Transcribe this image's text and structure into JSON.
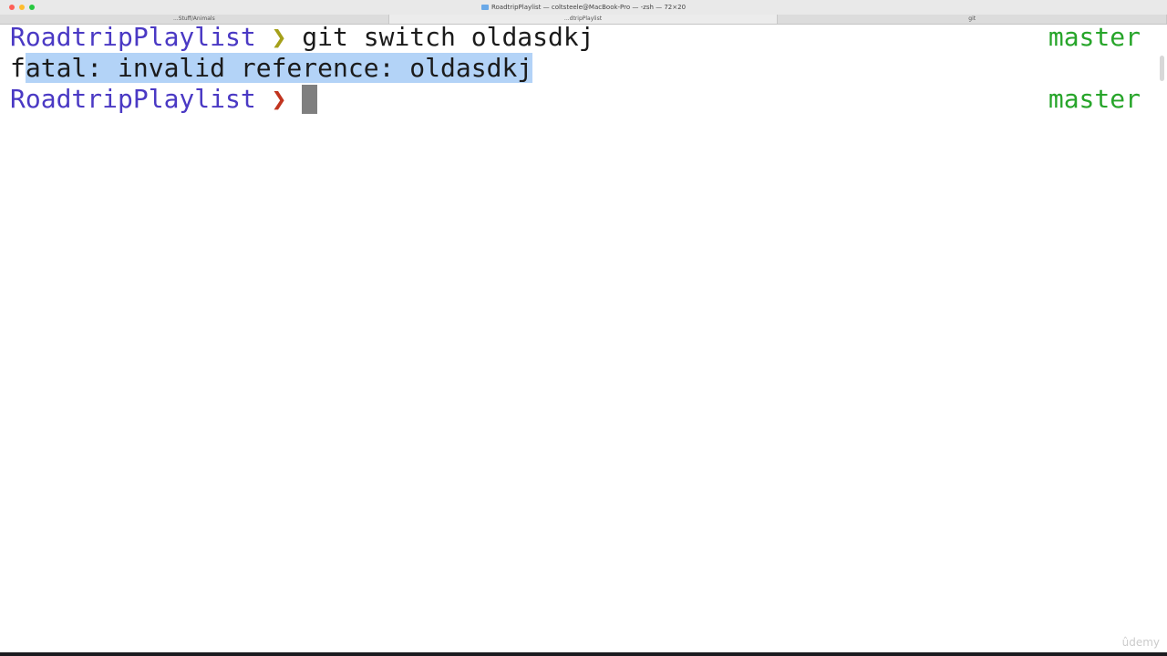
{
  "window": {
    "title": "RoadtripPlaylist — coltsteele@MacBook-Pro — -zsh — 72×20",
    "icon": "folder-icon"
  },
  "tabs": [
    {
      "label": "...Stuff/Animals",
      "active": false
    },
    {
      "label": "...dtripPlaylist",
      "active": true
    },
    {
      "label": "git",
      "active": false
    }
  ],
  "terminal": {
    "lines": [
      {
        "prompt_dir": "RoadtripPlaylist",
        "prompt_arrow": "❯",
        "arrow_status": "success",
        "command": " git switch oldasdkj",
        "branch": "master"
      },
      {
        "output_prefix": "f",
        "output_selected": "atal: invalid reference: oldasdkj"
      },
      {
        "prompt_dir": "RoadtripPlaylist",
        "prompt_arrow": "❯",
        "arrow_status": "error",
        "command": "",
        "branch": "master"
      }
    ]
  },
  "colors": {
    "prompt_dir": "#4a39c4",
    "arrow_success": "#a5a01a",
    "arrow_error": "#c1341f",
    "branch": "#27a52a",
    "selection": "#b3d3f7",
    "cursor": "#7f7f7f"
  },
  "watermark": "ûdemy"
}
